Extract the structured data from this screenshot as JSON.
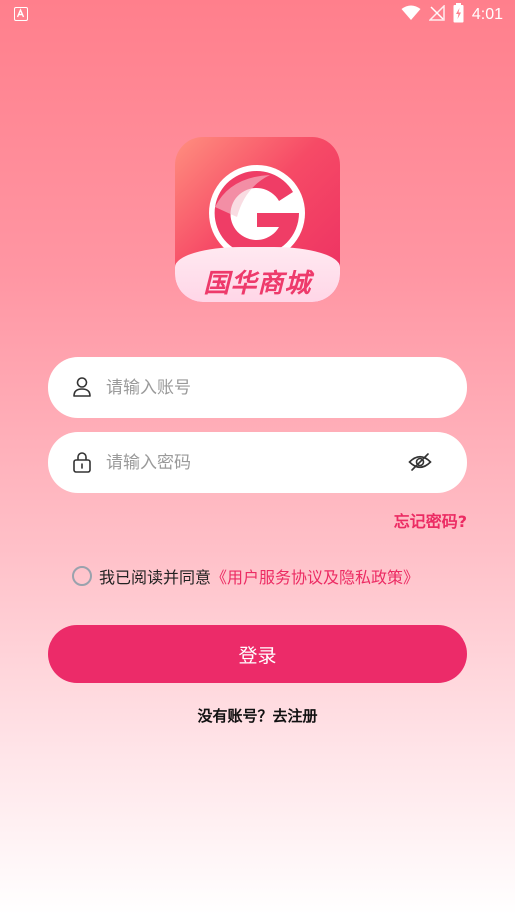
{
  "status_bar": {
    "notification_icon": "a-notification-icon",
    "time": "4:01",
    "icons": [
      "wifi-icon",
      "no-signal-icon",
      "battery-charging-icon"
    ]
  },
  "logo": {
    "icon": "g-logo-icon",
    "text": "国华商城"
  },
  "account_field": {
    "icon": "user-icon",
    "placeholder": "请输入账号",
    "value": ""
  },
  "password_field": {
    "icon": "lock-icon",
    "placeholder": "请输入密码",
    "value": "",
    "toggle_icon": "eye-closed-icon"
  },
  "forgot_password": "忘记密码?",
  "agreement": {
    "prefix": "我已阅读并同意",
    "link": "《用户服务协议及隐私政策》",
    "checked": false
  },
  "login_button": "登录",
  "register_link": "没有账号？去注册",
  "colors": {
    "accent": "#ec2b69",
    "link": "#ec2b63",
    "background_top": "#ff7f8c",
    "background_bottom": "#ffffff"
  }
}
